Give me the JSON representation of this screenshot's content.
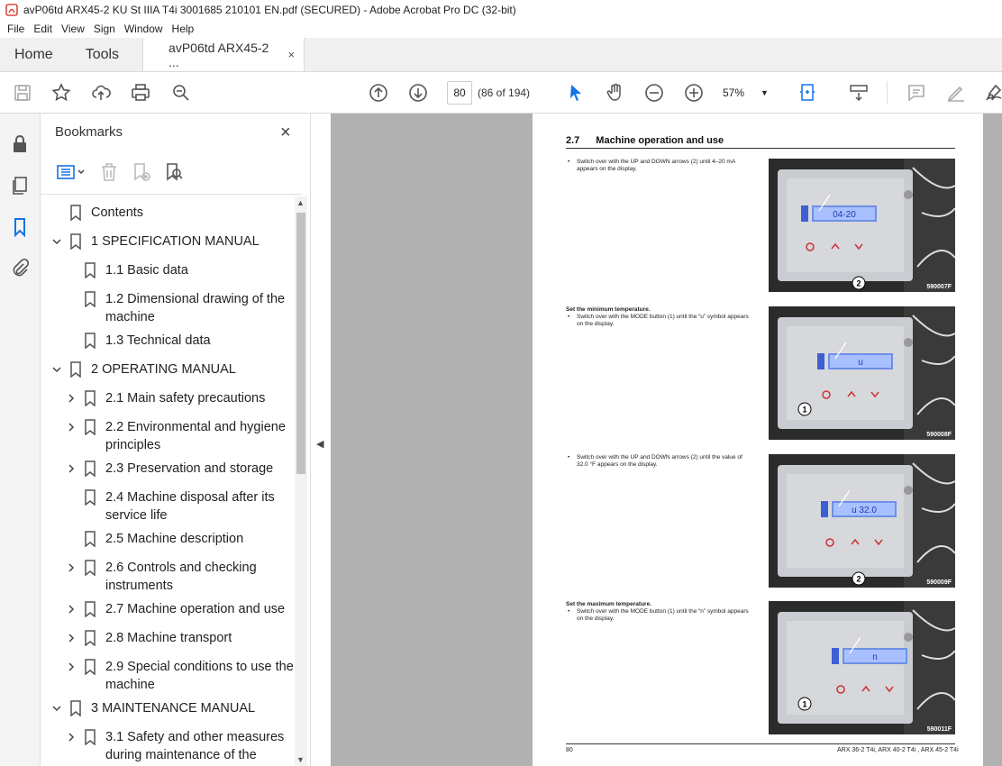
{
  "window": {
    "title": "avP06td ARX45-2 KU St IIIA T4i 3001685 210101 EN.pdf (SECURED) - Adobe Acrobat Pro DC (32-bit)"
  },
  "menu": [
    "File",
    "Edit",
    "View",
    "Sign",
    "Window",
    "Help"
  ],
  "tabs": {
    "home": "Home",
    "tools": "Tools",
    "doc": "avP06td ARX45-2 ...",
    "close": "×"
  },
  "toolbar": {
    "page_number": "80",
    "page_count": "(86 of 194)",
    "zoom": "57%"
  },
  "icons": {
    "save": "save-icon",
    "bookmark_star": "star-icon",
    "upload": "upload-icon",
    "print": "print-icon",
    "find": "search-icon",
    "prev": "arrow-up-circle-icon",
    "next": "arrow-down-circle-icon",
    "select": "pointer-icon",
    "hand": "hand-icon",
    "zoom_out": "zoom-out-icon",
    "zoom_in": "zoom-in-icon",
    "fit": "fit-page-icon",
    "scroll_mode": "scroll-mode-icon",
    "comment": "comment-icon",
    "highlight": "pen-icon",
    "sign": "sign-icon"
  },
  "bookmarks_panel": {
    "title": "Bookmarks",
    "close": "×",
    "items": [
      {
        "label": "Contents",
        "level": 0,
        "expand": "none"
      },
      {
        "label": "1 SPECIFICATION MANUAL",
        "level": 0,
        "expand": "open"
      },
      {
        "label": "1.1 Basic data",
        "level": 1,
        "expand": "none"
      },
      {
        "label": "1.2 Dimensional drawing of the machine",
        "level": 1,
        "expand": "none"
      },
      {
        "label": "1.3 Technical data",
        "level": 1,
        "expand": "none"
      },
      {
        "label": "2 OPERATING MANUAL",
        "level": 0,
        "expand": "open"
      },
      {
        "label": "2.1 Main safety precautions",
        "level": 1,
        "expand": "closed"
      },
      {
        "label": "2.2 Environmental and hygiene principles",
        "level": 1,
        "expand": "closed"
      },
      {
        "label": "2.3 Preservation and storage",
        "level": 1,
        "expand": "closed"
      },
      {
        "label": "2.4 Machine disposal after its service life",
        "level": 1,
        "expand": "none"
      },
      {
        "label": "2.5 Machine description",
        "level": 1,
        "expand": "none"
      },
      {
        "label": "2.6 Controls and checking instruments",
        "level": 1,
        "expand": "closed"
      },
      {
        "label": "2.7 Machine operation and use",
        "level": 1,
        "expand": "closed"
      },
      {
        "label": "2.8 Machine transport",
        "level": 1,
        "expand": "closed"
      },
      {
        "label": "2.9 Special conditions to use the machine",
        "level": 1,
        "expand": "closed"
      },
      {
        "label": "3 MAINTENANCE MANUAL",
        "level": 0,
        "expand": "open"
      },
      {
        "label": "3.1 Safety and other measures during maintenance of the",
        "level": 1,
        "expand": "closed"
      }
    ]
  },
  "page": {
    "section_number": "2.7",
    "section_title": "Machine operation and use",
    "blocks": [
      {
        "heading": "",
        "text": "Switch over with the UP and DOWN arrows (2) until 4–20 mA appears on the display.",
        "photo_code": "590007F",
        "display_text": "04-20",
        "callout": "2"
      },
      {
        "heading": "Set the minimum temperature.",
        "text": "Switch over with the MODE button (1) until the “u” symbol appears on the display.",
        "photo_code": "590008F",
        "display_text": "u",
        "callout": "1"
      },
      {
        "heading": "",
        "text": "Switch over with the UP and DOWN arrows (2) until the value of 32.0 °F appears on the display.",
        "photo_code": "590009F",
        "display_text": "u 32.0",
        "callout": "2"
      },
      {
        "heading": "Set the maximum temperature.",
        "text": "Switch over with the MODE button (1) until the “n” symbol appears on the display.",
        "photo_code": "590011F",
        "display_text": "n",
        "callout": "1"
      }
    ],
    "footer_page": "80",
    "footer_model": "ARX 36-2 T4i, ARX 40-2 T4i , ARX 45-2 T4i"
  }
}
